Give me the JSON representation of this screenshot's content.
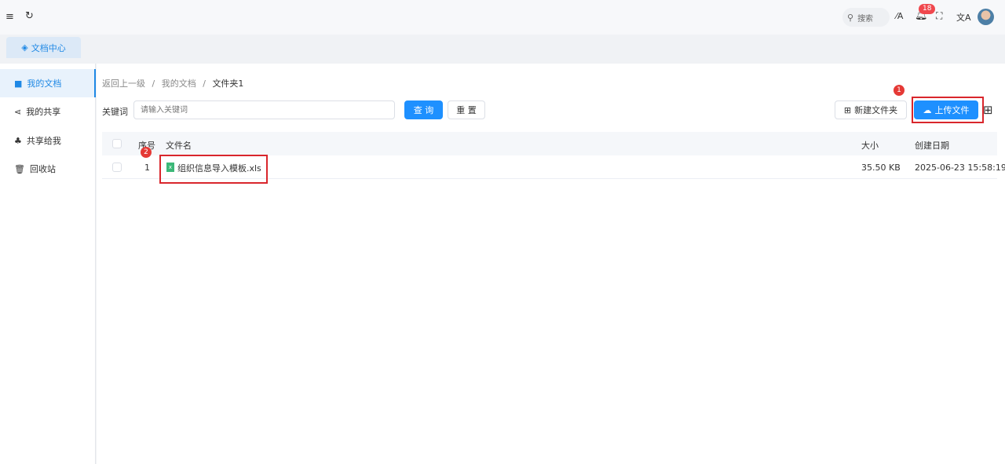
{
  "topbar": {
    "search_label": "搜索",
    "notification_count": "18"
  },
  "tabs": [
    {
      "label": "文档中心"
    }
  ],
  "sidebar": {
    "items": [
      {
        "label": "我的文档"
      },
      {
        "label": "我的共享"
      },
      {
        "label": "共享给我"
      },
      {
        "label": "回收站"
      }
    ]
  },
  "breadcrumb": {
    "back": "返回上一级",
    "sep": "/",
    "level1": "我的文档",
    "current": "文件夹1"
  },
  "filter": {
    "keyword_label": "关键词",
    "keyword_placeholder": "请输入关键词",
    "keyword_value": "",
    "query": "查 询",
    "reset": "重 置"
  },
  "actions": {
    "new_folder": "新建文件夹",
    "upload": "上传文件"
  },
  "annotations": {
    "a1": "1",
    "a2": "2"
  },
  "table": {
    "columns": {
      "index": "序号",
      "name": "文件名",
      "size": "大小",
      "created": "创建日期"
    },
    "rows": [
      {
        "index": "1",
        "name": "组织信息导入模板.xls",
        "size": "35.50 KB",
        "created": "2025-06-23 15:58:19"
      }
    ]
  }
}
